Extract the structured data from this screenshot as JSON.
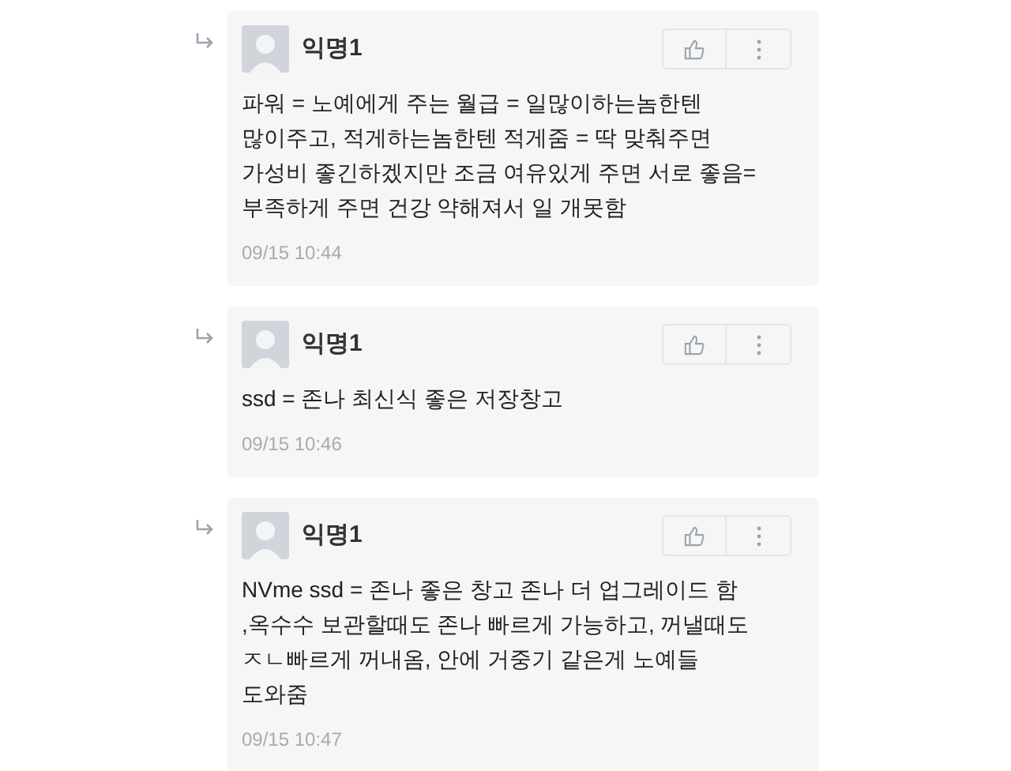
{
  "comments": [
    {
      "author": "익명1",
      "body": "파워 = 노예에게 주는 월급 = 일많이하는놈한텐\n많이주고, 적게하는놈한텐 적게줌 = 딱 맞춰주면\n가성비 좋긴하겠지만 조금 여유있게 주면 서로 좋음=\n부족하게 주면 건강 약해져서 일 개못함",
      "time": "09/15 10:44"
    },
    {
      "author": "익명1",
      "body": "ssd = 존나 최신식 좋은 저장창고",
      "time": "09/15 10:46"
    },
    {
      "author": "익명1",
      "body": "NVme ssd = 존나 좋은 창고 존나 더 업그레이드 함\n,옥수수 보관할때도 존나 빠르게 가능하고, 꺼낼때도\nㅈㄴ빠르게 꺼내옴, 안에 거중기 같은게 노예들\n도와줌",
      "time": "09/15 10:47"
    }
  ]
}
